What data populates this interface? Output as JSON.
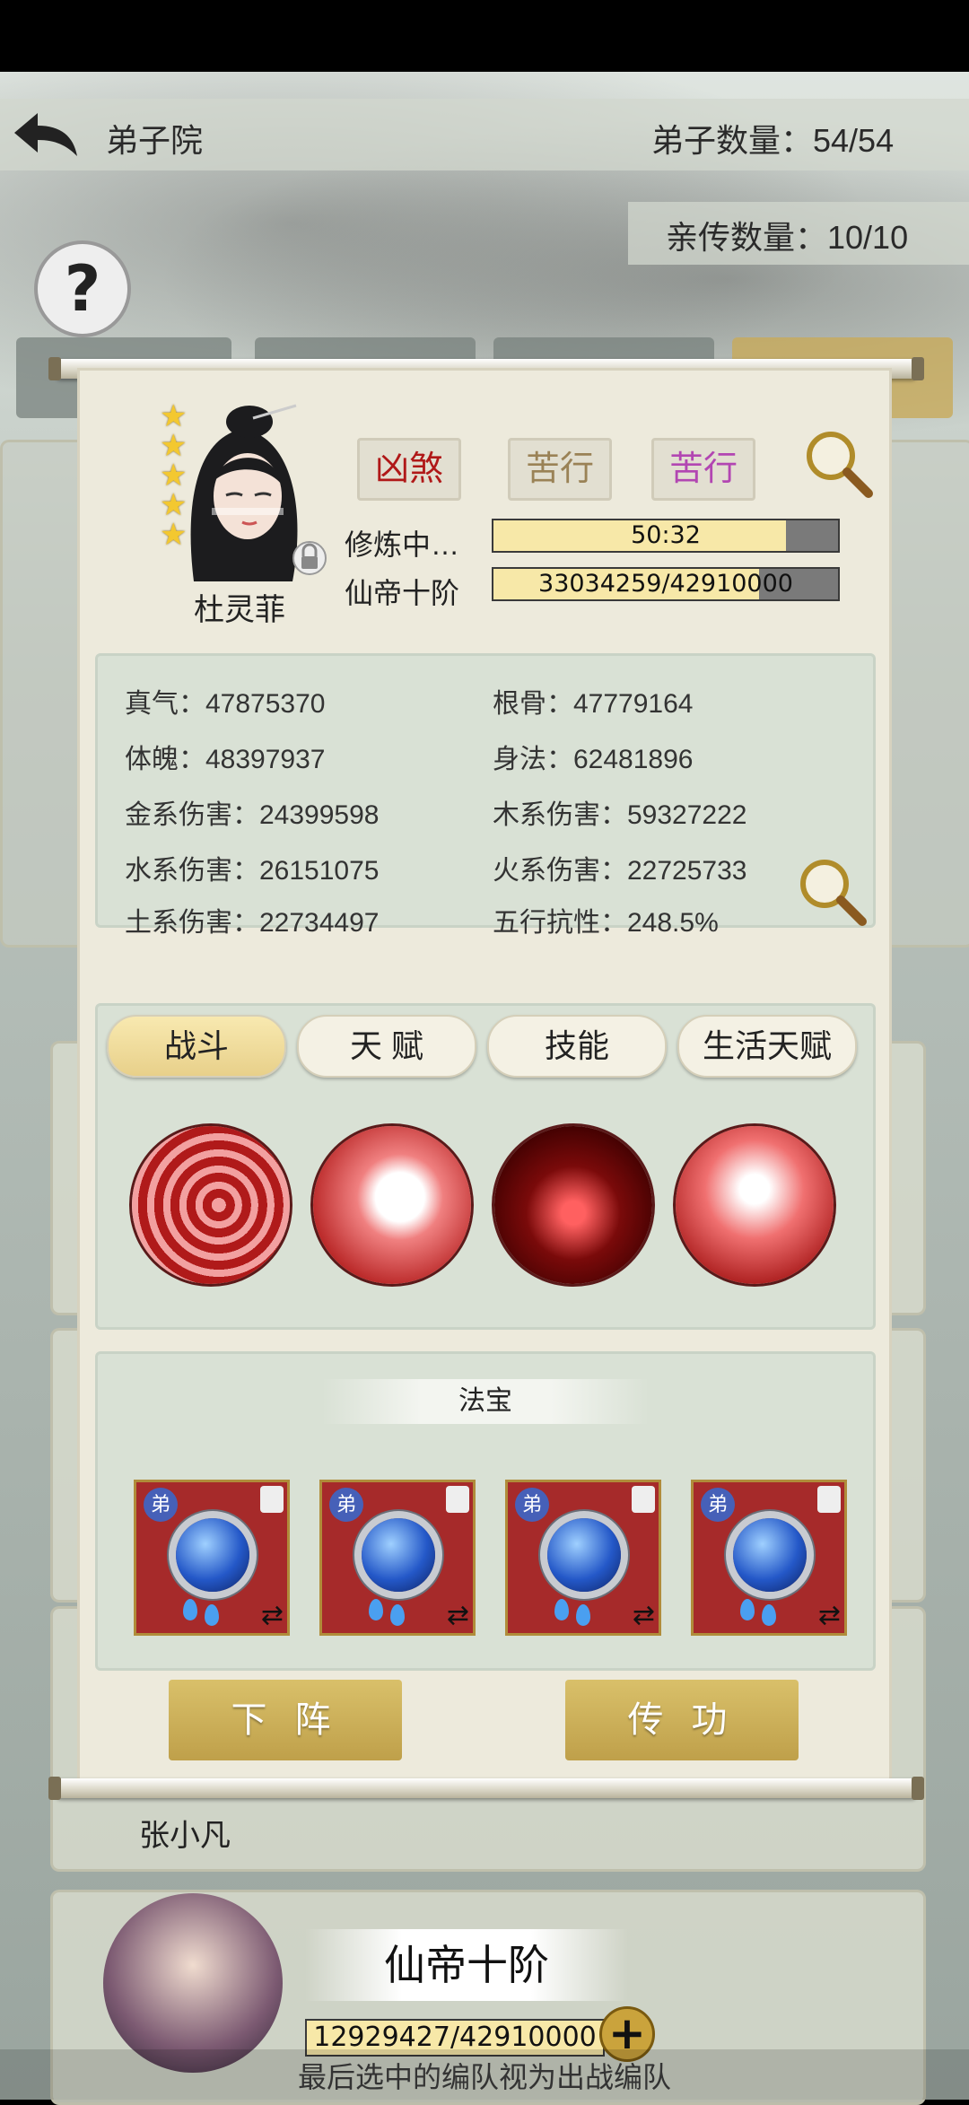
{
  "header": {
    "title": "弟子院",
    "disciple_count_label": "弟子数量：54/54",
    "direct_count_label": "亲传数量：10/10"
  },
  "detail": {
    "character_name": "杜灵菲",
    "star_count": 5,
    "tags": [
      "凶煞",
      "苦行",
      "苦行"
    ],
    "tag_colors": [
      "#b01818",
      "#9a8256",
      "#b246b2"
    ],
    "status_label": "修炼中…",
    "timer_text": "50:32",
    "timer_progress": 0.85,
    "rank_label": "仙帝十阶",
    "exp_text": "33034259/42910000",
    "exp_progress": 0.77
  },
  "stats": [
    {
      "label": "真气：47875370"
    },
    {
      "label": "根骨：47779164"
    },
    {
      "label": "体魄：48397937"
    },
    {
      "label": "身法：62481896"
    },
    {
      "label": "金系伤害：24399598"
    },
    {
      "label": "木系伤害：59327222"
    },
    {
      "label": "水系伤害：26151075"
    },
    {
      "label": "火系伤害：22725733"
    },
    {
      "label": "土系伤害：22734497"
    },
    {
      "label": "五行抗性：248.5%"
    }
  ],
  "tabs": [
    "战斗",
    "天 赋",
    "技能",
    "生活天赋"
  ],
  "active_tab": 0,
  "treasure_section_title": "法宝",
  "treasure_badge": "弟",
  "buttons": {
    "remove": "下 阵",
    "transfer": "传 功"
  },
  "background_list": {
    "name_under_panel": "张小凡",
    "next_rank": "仙帝十阶",
    "next_exp": "12929427/42910000",
    "plus": "+"
  },
  "footer_text": "最后选中的编队视为出战编队",
  "help_icon_text": "?"
}
